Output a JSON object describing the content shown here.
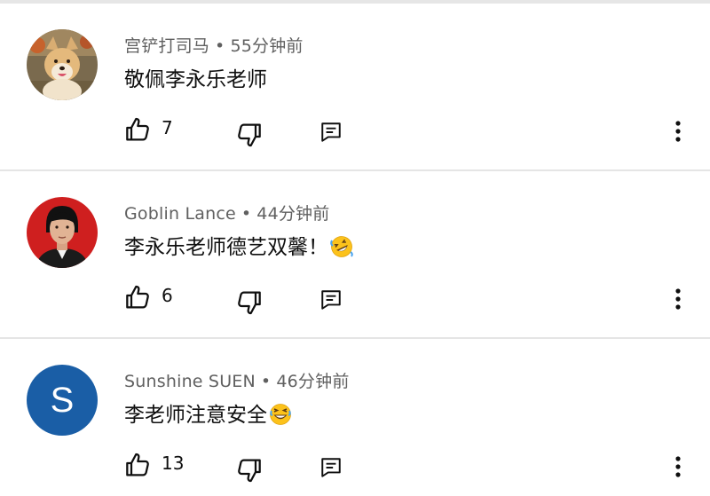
{
  "comments": [
    {
      "author": "宫铲打司马",
      "time": "55分钟前",
      "text": "敬佩李永乐老师",
      "likes": "7",
      "avatar": "dog-photo"
    },
    {
      "author": "Goblin Lance",
      "time": "44分钟前",
      "text": "李永乐老师德艺双馨！",
      "likes": "6",
      "avatar": "person-photo-red-background",
      "emoji": "rolling-on-floor-laughing-emoji"
    },
    {
      "author": "Sunshine SUEN",
      "time": "46分钟前",
      "text": "李老师注意安全",
      "likes": "13",
      "avatar_letter": "S",
      "avatar_color": "#1a5ea6",
      "emoji": "grinning-squinting-sweat-emoji"
    }
  ],
  "separator": "•"
}
